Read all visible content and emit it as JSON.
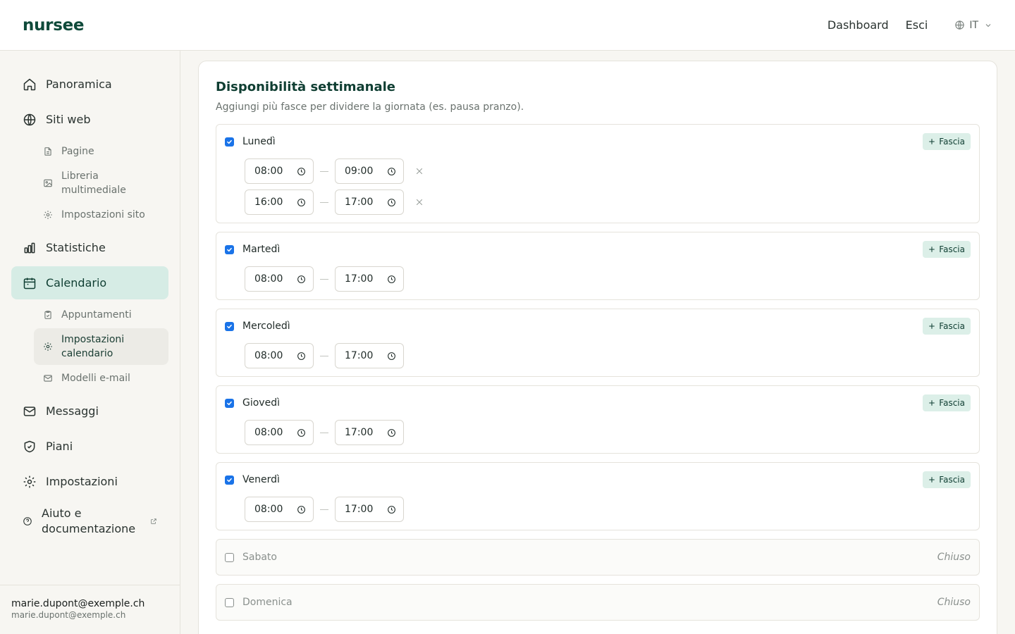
{
  "header": {
    "logo": "nursee",
    "nav": {
      "dashboard": "Dashboard",
      "logout": "Esci",
      "language": "IT"
    }
  },
  "sidebar": {
    "items": {
      "overview": "Panoramica",
      "websites": "Siti web",
      "pages": "Pagine",
      "media_library": "Libreria multimediale",
      "site_settings": "Impostazioni sito",
      "statistics": "Statistiche",
      "calendar": "Calendario",
      "appointments": "Appuntamenti",
      "calendar_settings": "Impostazioni calendario",
      "email_templates": "Modelli e-mail",
      "messages": "Messaggi",
      "plans": "Piani",
      "settings": "Impostazioni",
      "help": "Aiuto e documentazione"
    },
    "user": {
      "name": "marie.dupont@exemple.ch",
      "email": "marie.dupont@exemple.ch"
    }
  },
  "availability": {
    "title": "Disponibilità settimanale",
    "subtitle": "Aggiungi più fasce per dividere la giornata (es. pausa pranzo).",
    "add_slot_label": "Fascia",
    "closed_label": "Chiuso",
    "days": [
      {
        "name": "Lunedì",
        "enabled": true,
        "slots": [
          {
            "start": "08:00",
            "end": "09:00"
          },
          {
            "start": "16:00",
            "end": "17:00"
          }
        ]
      },
      {
        "name": "Martedì",
        "enabled": true,
        "slots": [
          {
            "start": "08:00",
            "end": "17:00"
          }
        ]
      },
      {
        "name": "Mercoledì",
        "enabled": true,
        "slots": [
          {
            "start": "08:00",
            "end": "17:00"
          }
        ]
      },
      {
        "name": "Giovedì",
        "enabled": true,
        "slots": [
          {
            "start": "08:00",
            "end": "17:00"
          }
        ]
      },
      {
        "name": "Venerdì",
        "enabled": true,
        "slots": [
          {
            "start": "08:00",
            "end": "17:00"
          }
        ]
      },
      {
        "name": "Sabato",
        "enabled": false,
        "slots": []
      },
      {
        "name": "Domenica",
        "enabled": false,
        "slots": []
      }
    ]
  },
  "colors": {
    "brand": "#0f4a3a",
    "active_nav_bg": "#d6ece5",
    "add_button_bg": "#dcefe8",
    "checkbox_checked": "#1a73e8"
  },
  "icons": {
    "overview": "home-icon",
    "websites": "globe-icon",
    "pages": "file-icon",
    "media_library": "image-icon",
    "site_settings": "gear-icon",
    "statistics": "bar-chart-icon",
    "calendar": "calendar-icon",
    "appointments": "clipboard-icon",
    "calendar_settings": "gear-icon",
    "email_templates": "mail-icon",
    "messages": "mail-icon",
    "plans": "shield-icon",
    "settings": "gear-icon",
    "help": "help-circle-icon",
    "time": "clock-icon",
    "remove": "close-icon",
    "add": "plus-icon",
    "language": "globe-icon"
  }
}
